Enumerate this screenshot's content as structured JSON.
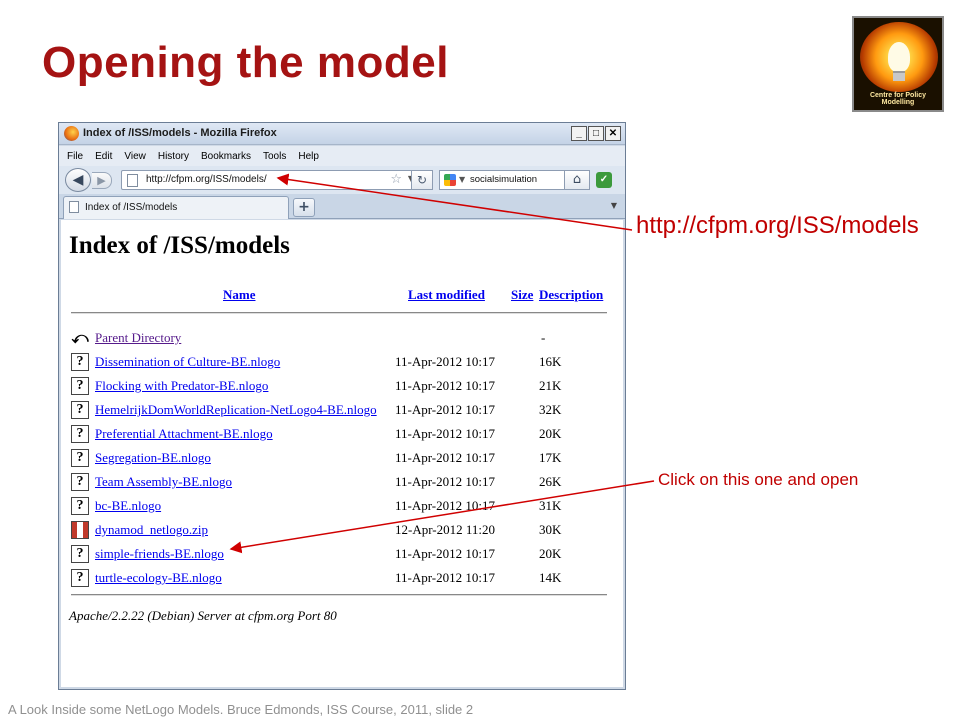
{
  "slide": {
    "title": "Opening the model",
    "footer": "A Look Inside some NetLogo Models. Bruce Edmonds,  ISS Course, 2011, slide 2",
    "annotation_url": "http://cfpm.org/ISS/models",
    "annotation_click": "Click on this one and open",
    "logo_text": "Centre for Policy Modelling",
    "accent_color": "#a51313",
    "annotation_color": "#c00000"
  },
  "browser": {
    "window_title": "Index of /ISS/models - Mozilla Firefox",
    "window_buttons": [
      "_",
      "□",
      "✕"
    ],
    "menu": [
      {
        "label": "File"
      },
      {
        "label": "Edit"
      },
      {
        "label": "View"
      },
      {
        "label": "History"
      },
      {
        "label": "Bookmarks"
      },
      {
        "label": "Tools"
      },
      {
        "label": "Help"
      }
    ],
    "url": "http://cfpm.org/ISS/models/",
    "search_text": "socialsimulation",
    "tab_label": "Index of /ISS/models",
    "icons": {
      "back": "back-arrow-icon",
      "forward": "forward-arrow-icon",
      "reload": "reload-icon",
      "home": "home-icon",
      "search": "magnifier-icon",
      "bookmark": "star-icon"
    }
  },
  "page": {
    "heading": "Index of /ISS/models",
    "columns": {
      "name": "Name",
      "last_modified": "Last modified",
      "size": "Size",
      "description": "Description"
    },
    "parent": {
      "name": "Parent Directory",
      "size": "-"
    },
    "rows": [
      {
        "name": "Dissemination of Culture-BE.nlogo",
        "date": "11-Apr-2012 10:17",
        "size": "16K",
        "icon": "unknown-file-icon"
      },
      {
        "name": "Flocking with Predator-BE.nlogo",
        "date": "11-Apr-2012 10:17",
        "size": "21K",
        "icon": "unknown-file-icon"
      },
      {
        "name": "HemelrijkDomWorldReplication-NetLogo4-BE.nlogo",
        "date": "11-Apr-2012 10:17",
        "size": "32K",
        "icon": "unknown-file-icon"
      },
      {
        "name": "Preferential Attachment-BE.nlogo",
        "date": "11-Apr-2012 10:17",
        "size": "20K",
        "icon": "unknown-file-icon"
      },
      {
        "name": "Segregation-BE.nlogo",
        "date": "11-Apr-2012 10:17",
        "size": "17K",
        "icon": "unknown-file-icon"
      },
      {
        "name": "Team Assembly-BE.nlogo",
        "date": "11-Apr-2012 10:17",
        "size": "26K",
        "icon": "unknown-file-icon"
      },
      {
        "name": "bc-BE.nlogo",
        "date": "11-Apr-2012 10:17",
        "size": "31K",
        "icon": "unknown-file-icon"
      },
      {
        "name": "dynamod_netlogo.zip",
        "date": "12-Apr-2012 11:20",
        "size": "30K",
        "icon": "zip-file-icon"
      },
      {
        "name": "simple-friends-BE.nlogo",
        "date": "11-Apr-2012 10:17",
        "size": "20K",
        "icon": "unknown-file-icon"
      },
      {
        "name": "turtle-ecology-BE.nlogo",
        "date": "11-Apr-2012 10:17",
        "size": "14K",
        "icon": "unknown-file-icon"
      }
    ],
    "server_signature": "Apache/2.2.22 (Debian) Server at cfpm.org Port 80"
  }
}
